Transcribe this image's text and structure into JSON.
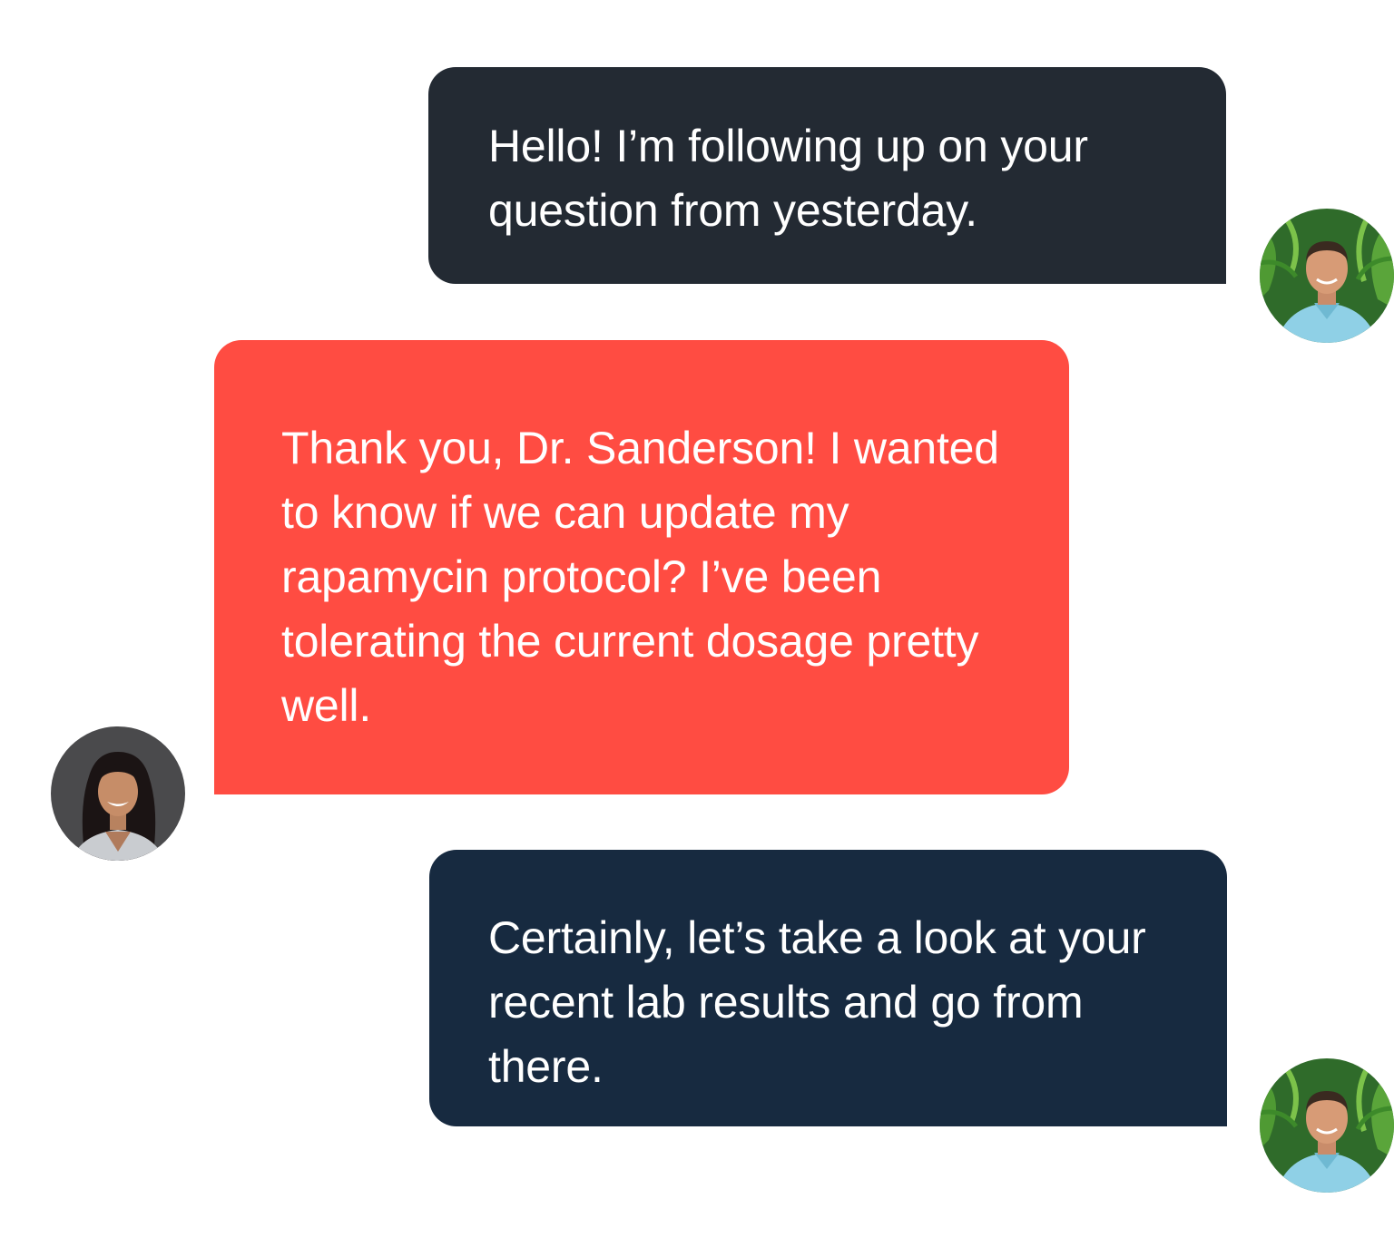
{
  "colors": {
    "doctor_bubble_1": "#232a33",
    "patient_bubble": "#ff4c42",
    "doctor_bubble_2": "#172a40",
    "text": "#ffffff",
    "background": "#ffffff"
  },
  "messages": [
    {
      "sender": "doctor",
      "text": "Hello! I’m following up on your question from yesterday."
    },
    {
      "sender": "patient",
      "text": "Thank you, Dr. Sanderson! I wanted to know if we can update my rapamycin protocol? I’ve been tolerating the current dosage pretty well."
    },
    {
      "sender": "doctor",
      "text": "Certainly, let’s take a look at your recent lab results and go from there."
    }
  ]
}
